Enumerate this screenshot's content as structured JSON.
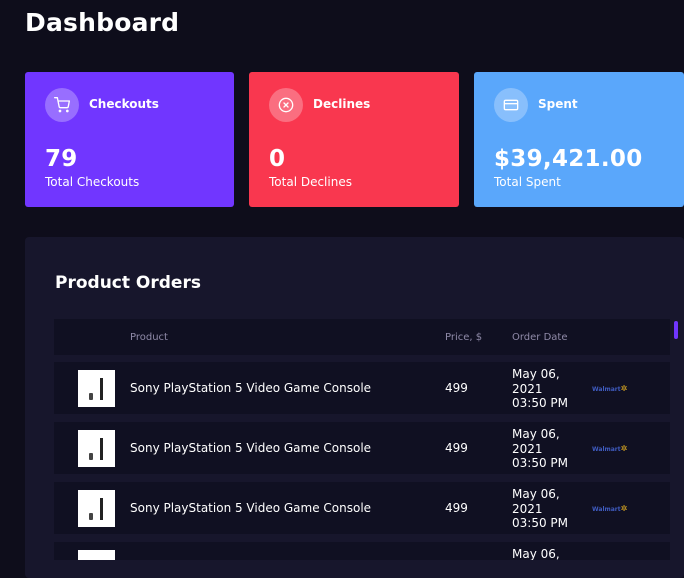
{
  "page": {
    "title": "Dashboard"
  },
  "cards": [
    {
      "label": "Checkouts",
      "value": "79",
      "sub": "Total Checkouts",
      "icon": "cart-icon",
      "color": "#7136ff"
    },
    {
      "label": "Declines",
      "value": "0",
      "sub": "Total Declines",
      "icon": "x-circle-icon",
      "color": "#f9374f"
    },
    {
      "label": "Spent",
      "value": "$39,421.00",
      "sub": "Total Spent",
      "icon": "credit-card-icon",
      "color": "#5aa7fb"
    }
  ],
  "orders": {
    "title": "Product Orders",
    "columns": {
      "product": "Product",
      "price": "Price, $",
      "date": "Order Date"
    },
    "rows": [
      {
        "product": "Sony PlayStation 5 Video Game Console",
        "price": "499",
        "date": "May 06,\n2021\n03:50 PM",
        "store": "Walmart"
      },
      {
        "product": "Sony PlayStation 5 Video Game Console",
        "price": "499",
        "date": "May 06,\n2021\n03:50 PM",
        "store": "Walmart"
      },
      {
        "product": "Sony PlayStation 5 Video Game Console",
        "price": "499",
        "date": "May 06,\n2021\n03:50 PM",
        "store": "Walmart"
      },
      {
        "product": "",
        "price": "",
        "date": "May 06,",
        "store": ""
      }
    ]
  }
}
